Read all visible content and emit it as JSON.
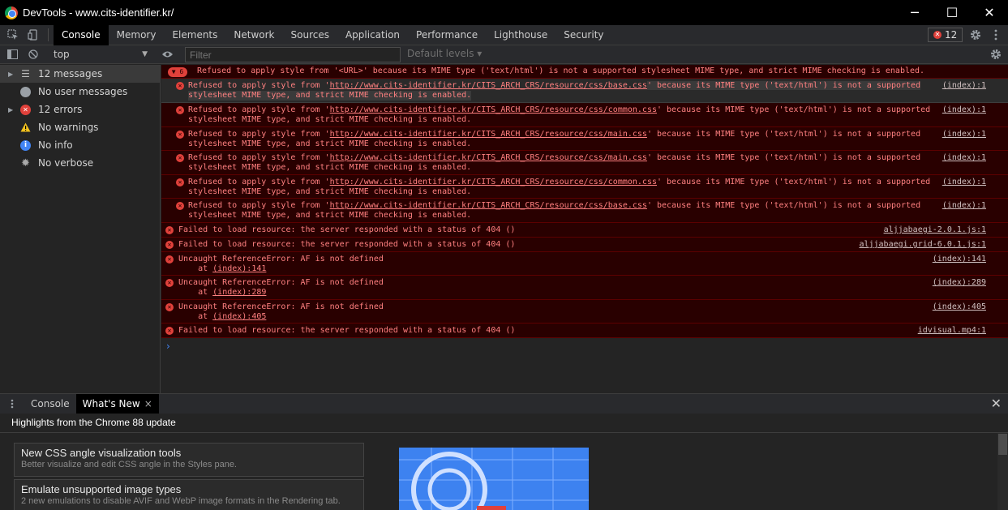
{
  "window": {
    "title": "DevTools - www.cits-identifier.kr/",
    "minimize": "─",
    "maximize": "☐",
    "close": "✕"
  },
  "main_tabs": [
    "Console",
    "Memory",
    "Elements",
    "Network",
    "Sources",
    "Application",
    "Performance",
    "Lighthouse",
    "Security"
  ],
  "error_badge_count": "12",
  "console_toolbar": {
    "context": "top",
    "filter_placeholder": "Filter",
    "levels": "Default levels ▾"
  },
  "sidebar": {
    "items": [
      {
        "label": "12 messages",
        "icon": "list-icon"
      },
      {
        "label": "No user messages",
        "icon": "user-icon"
      },
      {
        "label": "12 errors",
        "icon": "error-icon"
      },
      {
        "label": "No warnings",
        "icon": "warning-icon"
      },
      {
        "label": "No info",
        "icon": "info-icon"
      },
      {
        "label": "No verbose",
        "icon": "verbose-icon"
      }
    ]
  },
  "messages": {
    "group_count": "6",
    "group_text": "Refused to apply style from '<URL>' because its MIME type ('text/html') is not a supported stylesheet MIME type, and strict MIME checking is enabled.",
    "refused": [
      {
        "pre": "Refused to apply style from '",
        "url": "http://www.cits-identifier.kr/CITS_ARCH_CRS/resource/css/base.css",
        "post": "' because its MIME type ('text/html') is not a supported",
        "line2": "stylesheet MIME type, and strict MIME checking is enabled.",
        "src": "(index):1"
      },
      {
        "pre": "Refused to apply style from '",
        "url": "http://www.cits-identifier.kr/CITS_ARCH_CRS/resource/css/common.css",
        "post": "' because its MIME type ('text/html') is not a supported",
        "line2": "stylesheet MIME type, and strict MIME checking is enabled.",
        "src": "(index):1"
      },
      {
        "pre": "Refused to apply style from '",
        "url": "http://www.cits-identifier.kr/CITS_ARCH_CRS/resource/css/main.css",
        "post": "' because its MIME type ('text/html') is not a supported",
        "line2": "stylesheet MIME type, and strict MIME checking is enabled.",
        "src": "(index):1"
      },
      {
        "pre": "Refused to apply style from '",
        "url": "http://www.cits-identifier.kr/CITS_ARCH_CRS/resource/css/main.css",
        "post": "' because its MIME type ('text/html') is not a supported",
        "line2": "stylesheet MIME type, and strict MIME checking is enabled.",
        "src": "(index):1"
      },
      {
        "pre": "Refused to apply style from '",
        "url": "http://www.cits-identifier.kr/CITS_ARCH_CRS/resource/css/common.css",
        "post": "' because its MIME type ('text/html') is not a supported",
        "line2": "stylesheet MIME type, and strict MIME checking is enabled.",
        "src": "(index):1"
      },
      {
        "pre": "Refused to apply style from '",
        "url": "http://www.cits-identifier.kr/CITS_ARCH_CRS/resource/css/base.css",
        "post": "' because its MIME type ('text/html') is not a supported",
        "line2": "stylesheet MIME type, and strict MIME checking is enabled.",
        "src": "(index):1"
      }
    ],
    "others": [
      {
        "text": "Failed to load resource: the server responded with a status of 404 ()",
        "src": "aljjabaegi-2.0.1.js:1"
      },
      {
        "text": "Failed to load resource: the server responded with a status of 404 ()",
        "src": "aljjabaegi.grid-6.0.1.js:1"
      },
      {
        "text": "Uncaught ReferenceError: AF is not defined",
        "at": "    at ",
        "at_link": "(index):141",
        "src": "(index):141"
      },
      {
        "text": "Uncaught ReferenceError: AF is not defined",
        "at": "    at ",
        "at_link": "(index):289",
        "src": "(index):289"
      },
      {
        "text": "Uncaught ReferenceError: AF is not defined",
        "at": "    at ",
        "at_link": "(index):405",
        "src": "(index):405"
      },
      {
        "text": "Failed to load resource: the server responded with a status of 404 ()",
        "src": "idvisual.mp4:1"
      }
    ],
    "prompt": "›"
  },
  "drawer": {
    "tabs": [
      "Console",
      "What's New"
    ],
    "whats_new_close": "×",
    "close": "✕",
    "header": "Highlights from the Chrome 88 update",
    "cards": [
      {
        "title": "New CSS angle visualization tools",
        "desc": "Better visualize and edit CSS angle in the Styles pane."
      },
      {
        "title": "Emulate unsupported image types",
        "desc": "2 new emulations to disable AVIF and WebP image formats in the Rendering tab."
      }
    ]
  },
  "colors": {
    "error": "#e0413b",
    "error_bg": "#290000",
    "error_text": "#ff8080",
    "accent": "#4285f4"
  }
}
